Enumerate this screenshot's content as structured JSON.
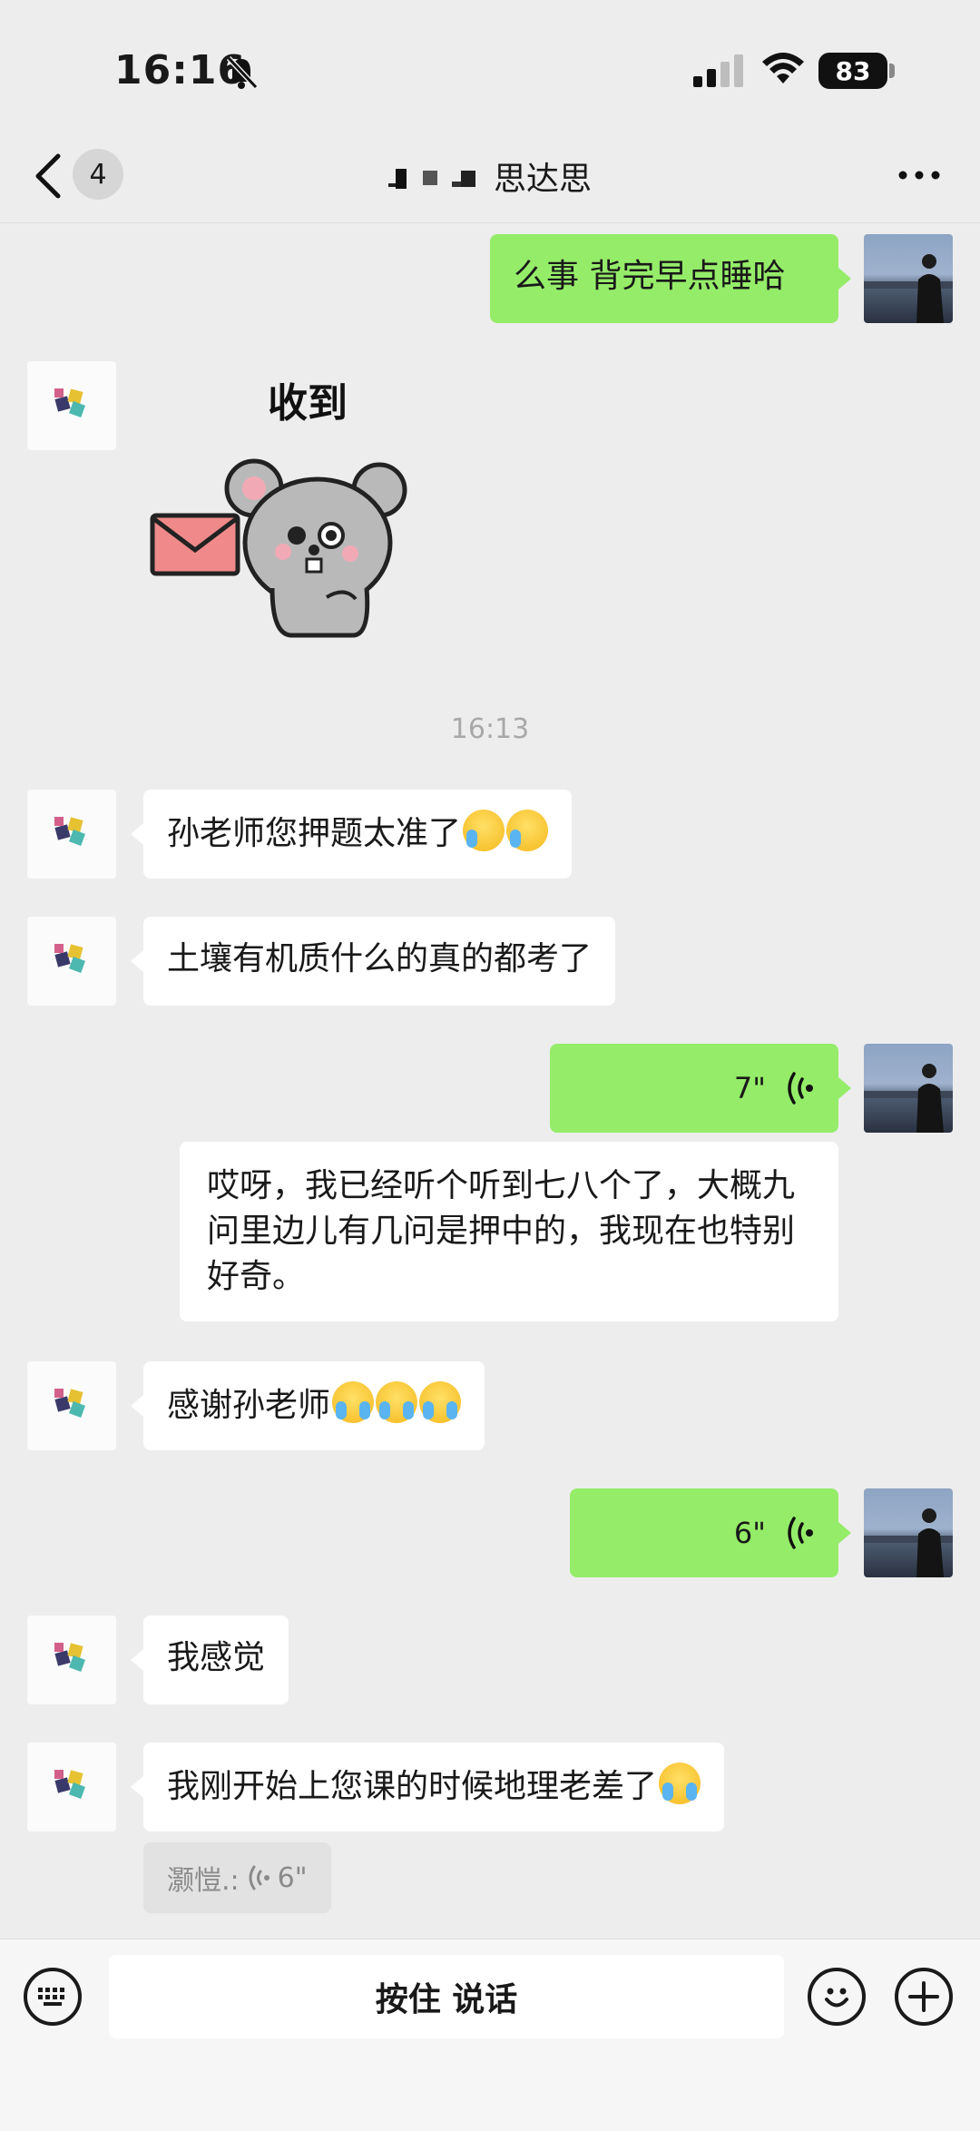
{
  "status_bar": {
    "time": "16:16",
    "battery": "83",
    "icons": [
      "bell-muted-icon",
      "signal-icon",
      "wifi-icon",
      "battery-icon"
    ]
  },
  "nav": {
    "unread_count": "4",
    "title": "思达思",
    "icons": [
      "back-chevron-icon",
      "more-dots-icon"
    ]
  },
  "messages": {
    "m1": "么事 背完早点睡哈",
    "sticker_text": "收到",
    "timestamp": "16:13",
    "m2_text": "孙老师您押题太准了",
    "m3": "土壤有机质什么的真的都考了",
    "voice1_duration": "7\"",
    "voice1_transcript": "哎呀，我已经听个听到七八个了，大概九问里边儿有几问是押中的，我现在也特别好奇。",
    "m4_text": "感谢孙老师",
    "voice2_duration": "6\"",
    "m5": "我感觉",
    "m6_text": "我刚开始上您课的时候地理老差了",
    "pending_voice": "灏愷.: ",
    "pending_voice_duration": "6\""
  },
  "input_bar": {
    "press_to_talk": "按住 说话",
    "icons": [
      "keyboard-icon",
      "emoji-icon",
      "plus-icon"
    ]
  },
  "colors": {
    "background": "#ededed",
    "bubble_self": "#95ec69",
    "bubble_other": "#ffffff",
    "timestamp": "#a8a8a8"
  }
}
